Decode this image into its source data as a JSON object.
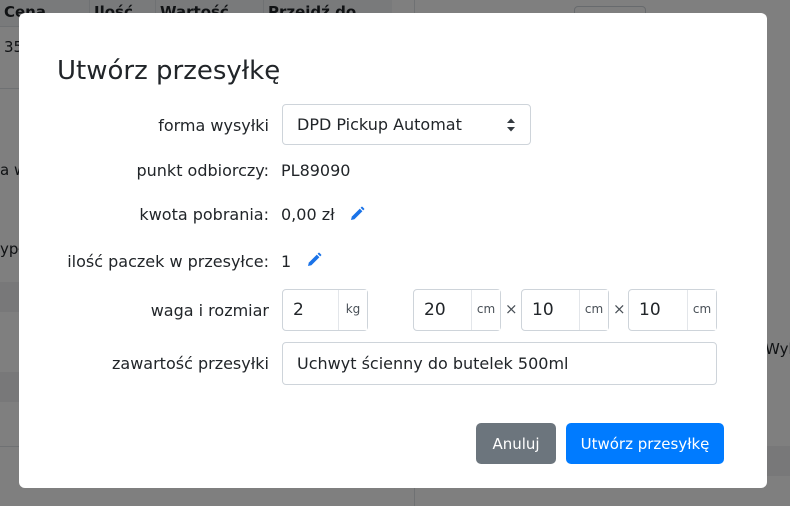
{
  "background": {
    "table_headers": [
      "Cena",
      "Ilość",
      "Wartość",
      "Przejdź do"
    ],
    "cell_value": "35",
    "fragment_1": "a w",
    "fragment_2": "ypła",
    "fragment_3": "Wyb"
  },
  "modal": {
    "title": "Utwórz przesyłkę",
    "shipping_form": {
      "label": "forma wysyłki",
      "selected": "DPD Pickup Automat"
    },
    "pickup_point": {
      "label": "punkt odbiorczy:",
      "value": "PL89090"
    },
    "cod_amount": {
      "label": "kwota pobrania:",
      "value": "0,00 zł"
    },
    "package_count": {
      "label": "ilość paczek w przesyłce:",
      "value": "1"
    },
    "weight_size": {
      "label": "waga i rozmiar",
      "weight": "2",
      "weight_unit": "kg",
      "length": "20",
      "width": "10",
      "height": "10",
      "dim_unit": "cm",
      "separator": "×"
    },
    "contents": {
      "label": "zawartość przesyłki",
      "value": "Uchwyt ścienny do butelek 500ml"
    },
    "buttons": {
      "cancel": "Anuluj",
      "create": "Utwórz przesyłkę"
    }
  },
  "colors": {
    "primary": "#007bff",
    "secondary": "#6c757d",
    "pencil": "#1a73e8"
  }
}
